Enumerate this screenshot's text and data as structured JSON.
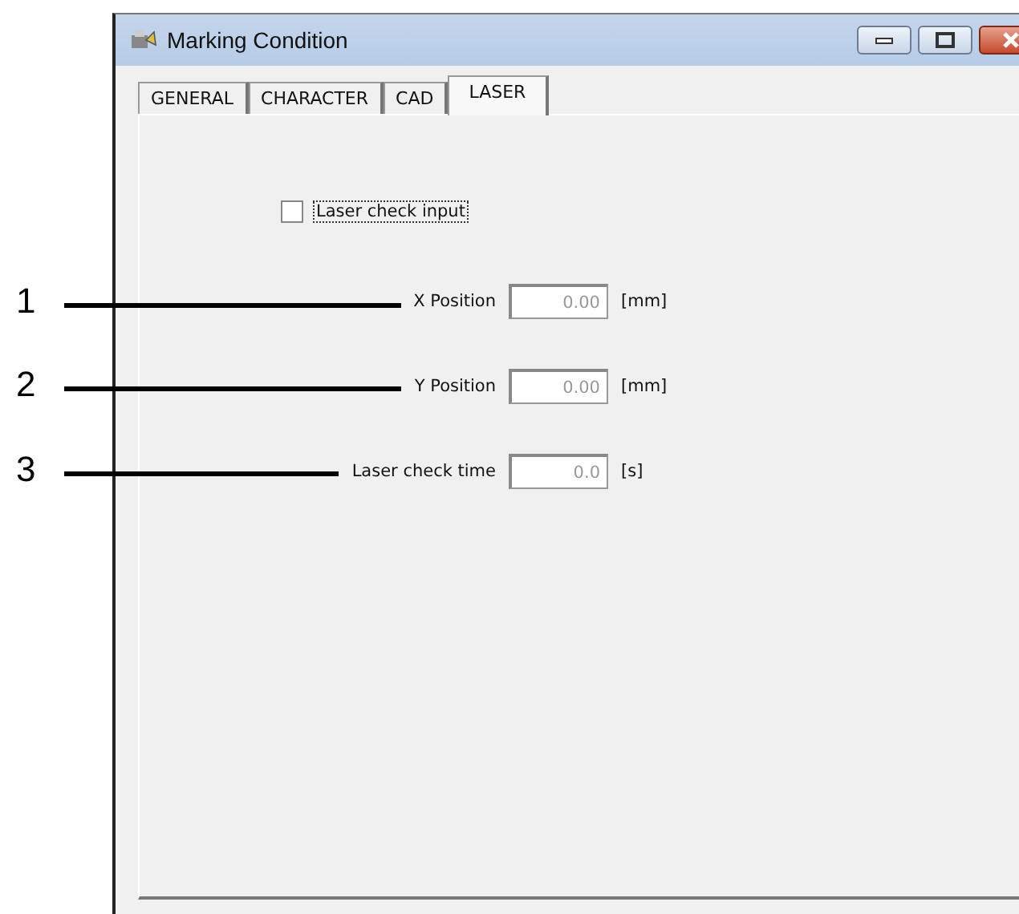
{
  "window": {
    "title": "Marking Condition"
  },
  "tabs": [
    {
      "label": "GENERAL",
      "selected": false
    },
    {
      "label": "CHARACTER",
      "selected": false
    },
    {
      "label": "CAD",
      "selected": false
    },
    {
      "label": "LASER",
      "selected": true
    }
  ],
  "laser_check_input": {
    "label": "Laser check input",
    "checked": false
  },
  "fields": [
    {
      "label": "X Position",
      "value": "0.00",
      "unit": "[mm]",
      "callout": "1"
    },
    {
      "label": "Y Position",
      "value": "0.00",
      "unit": "[mm]",
      "callout": "2"
    },
    {
      "label": "Laser check time",
      "value": "0.0",
      "unit": "[s]",
      "callout": "3"
    }
  ]
}
